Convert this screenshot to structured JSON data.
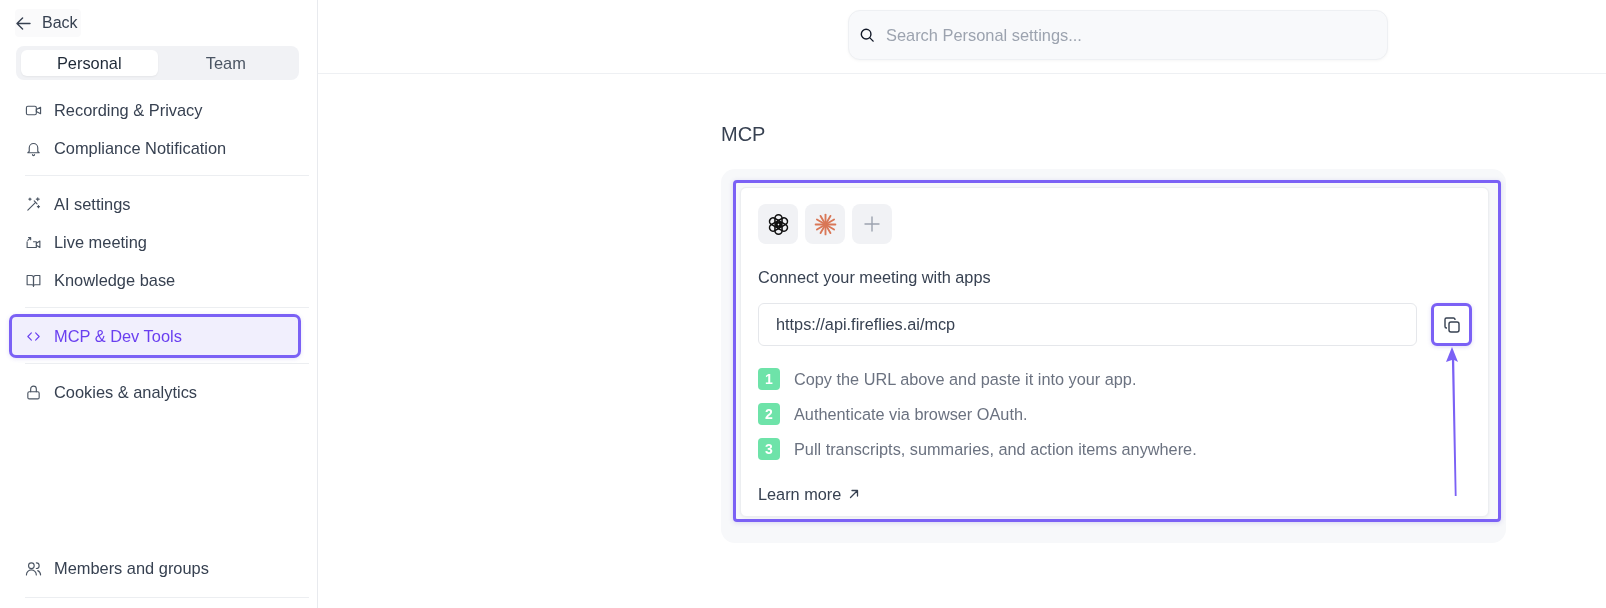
{
  "sidebar": {
    "back": {
      "label": "Back"
    },
    "tabs": [
      {
        "label": "Personal",
        "selected": true
      },
      {
        "label": "Team",
        "selected": false
      }
    ],
    "sections": [
      {
        "items": [
          {
            "label": "Recording & Privacy",
            "selected": false,
            "highlighted": false
          },
          {
            "label": "Compliance Notification",
            "selected": false,
            "highlighted": false
          }
        ]
      },
      {
        "items": [
          {
            "label": "AI settings",
            "selected": false,
            "highlighted": false
          },
          {
            "label": "Live meeting",
            "selected": false,
            "highlighted": false
          },
          {
            "label": "Knowledge base",
            "selected": false,
            "highlighted": false
          }
        ]
      },
      {
        "items": [
          {
            "label": "MCP & Dev Tools",
            "selected": true,
            "highlighted": true
          }
        ]
      },
      {
        "items": [
          {
            "label": "Cookies & analytics",
            "selected": false,
            "highlighted": false
          }
        ]
      }
    ],
    "bottom_items": [
      {
        "label": "Members and groups",
        "selected": false,
        "highlighted": false
      }
    ]
  },
  "search": {
    "placeholder": "Search Personal settings..."
  },
  "main": {
    "title": "MCP",
    "card": {
      "highlighted": true,
      "heading": "Connect your meeting with apps",
      "url_field": {
        "value": "https://api.fireflies.ai/mcp"
      },
      "copy_button": {
        "highlighted": true,
        "pointer_arrow": true
      },
      "steps": [
        {
          "number": "1",
          "text": "Copy the URL above and paste it into your app."
        },
        {
          "number": "2",
          "text": "Authenticate via browser OAuth."
        },
        {
          "number": "3",
          "text": "Pull transcripts, summaries, and action items anywhere."
        }
      ],
      "learn_more": {
        "label": "Learn more"
      }
    }
  }
}
